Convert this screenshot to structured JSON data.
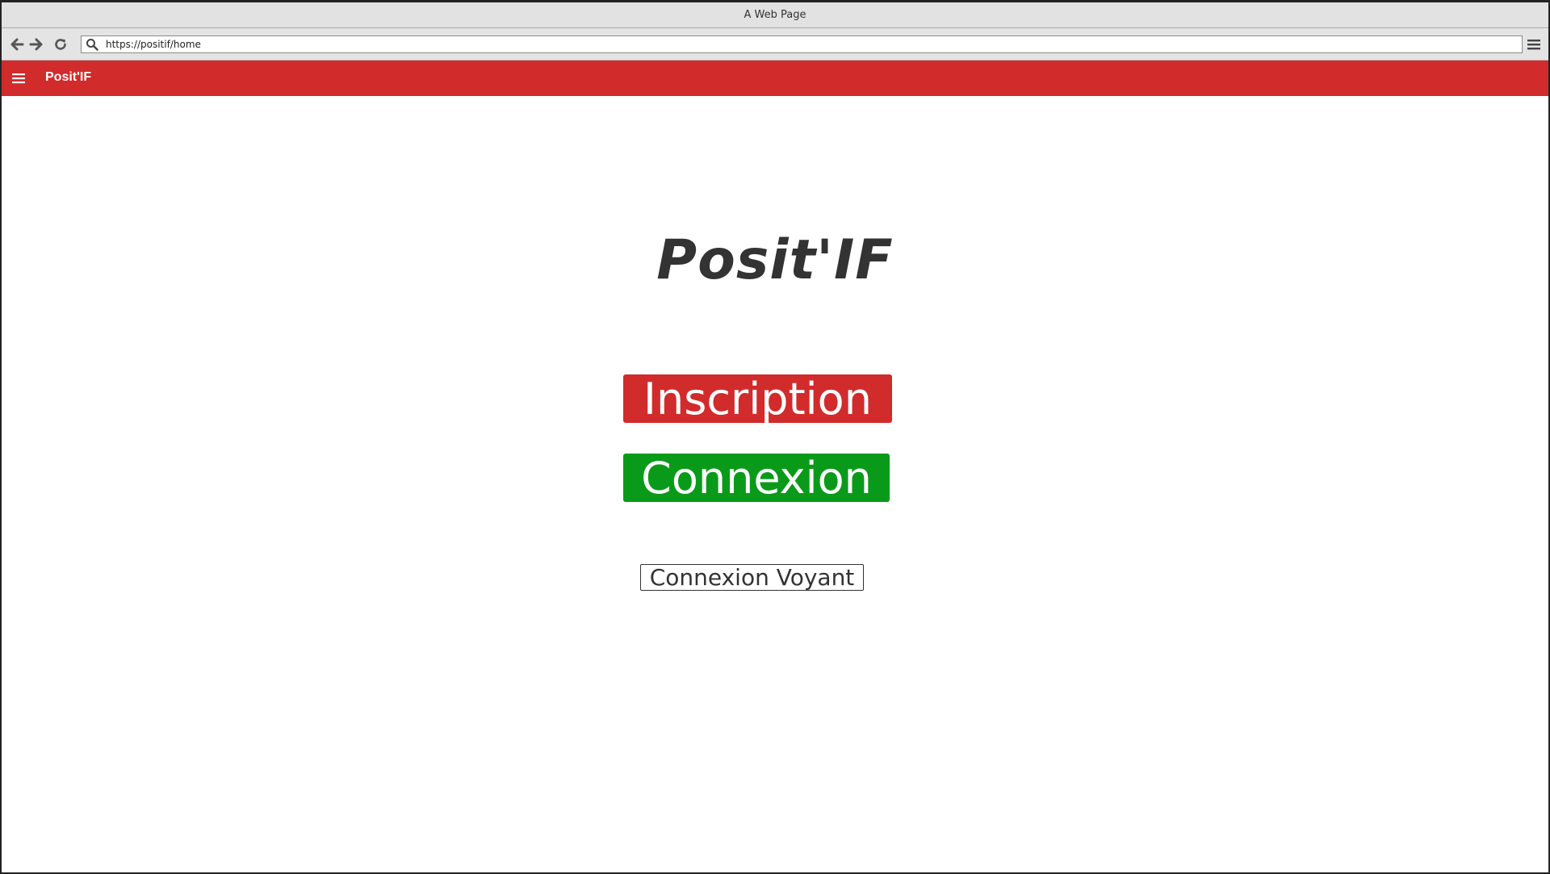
{
  "window": {
    "title": "A Web Page"
  },
  "browser": {
    "url": "https://positif/home",
    "icons": {
      "back": "arrow-left-icon",
      "forward": "arrow-right-icon",
      "reload": "reload-icon",
      "search": "search-icon",
      "menu": "menu-icon"
    }
  },
  "appbar": {
    "title": "Posit'IF",
    "menu_icon": "hamburger-icon",
    "color": "#d12b2b"
  },
  "main": {
    "brand": "Posit'IF",
    "buttons": {
      "inscription": "Inscription",
      "connexion": "Connexion",
      "connexion_voyant": "Connexion Voyant"
    }
  },
  "colors": {
    "primary": "#d12b2b",
    "success": "#0a9a1a",
    "text": "#333333"
  }
}
